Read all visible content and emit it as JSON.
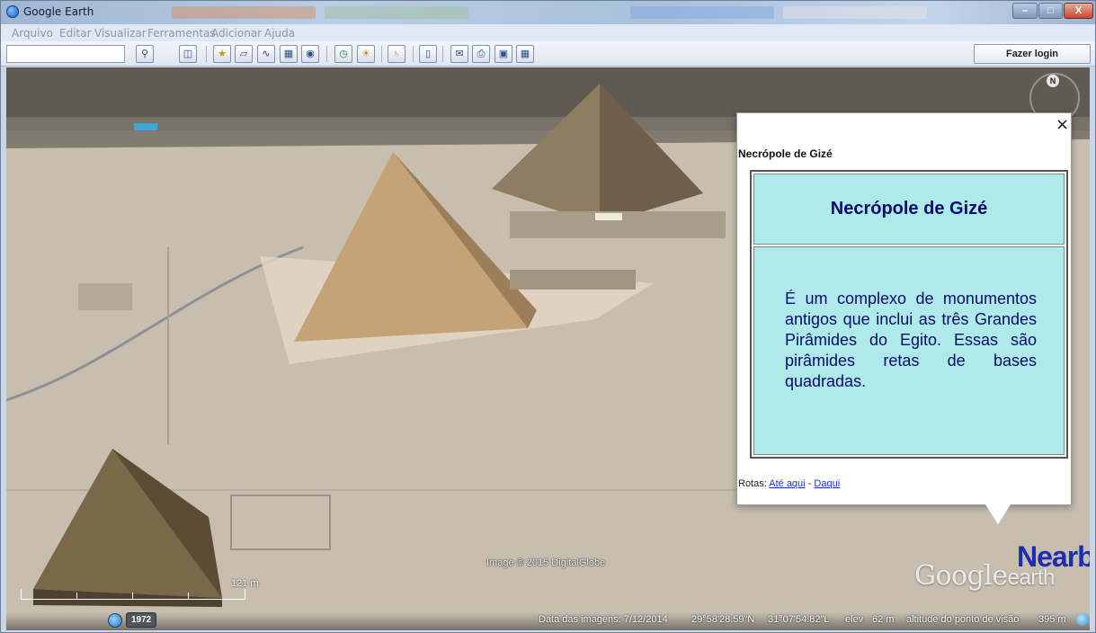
{
  "window": {
    "title": "Google Earth",
    "controls": {
      "minimize": "–",
      "maximize": "□",
      "close": "X"
    }
  },
  "menu": [
    "Arquivo",
    "Editar",
    "Visualizar",
    "Ferramentas",
    "Adicionar",
    "Ajuda"
  ],
  "toolbar": {
    "search_value": "",
    "login_label": "Fazer login",
    "icons": [
      "search-icon",
      "sidebar-toggle-icon",
      "add-placemark-icon",
      "add-polygon-icon",
      "add-path-icon",
      "add-overlay-icon",
      "record-tour-icon",
      "historical-imagery-icon",
      "sunlight-icon",
      "planets-icon",
      "ruler-icon",
      "email-icon",
      "print-icon",
      "save-image-icon",
      "view-in-maps-icon"
    ]
  },
  "balloon": {
    "close": "×",
    "title": "Necrópole de Gizé",
    "heading": "Necrópole de Gizé",
    "description": "É um complexo de monumentos antigos que inclui as três Grandes Pirâmides do Egito. Essas são pirâmides retas de bases quadradas.",
    "routes_prefix": "Rotas:",
    "route_to": "Até aqui",
    "route_separator": "-",
    "route_from": "Daqui"
  },
  "viewport": {
    "imagery_credit": "Image © 2015 DigitalGlobe",
    "logo_main": "Google",
    "logo_suffix": "earth",
    "scale_label": "121 m",
    "compass_label": "N",
    "historical_year": "1972",
    "nearby_fragment": "Nearb"
  },
  "status": {
    "imagery_date": "Data das imagens: 7/12/2014",
    "latitude": "29°58'28.59\"N",
    "longitude": "31°07'54.82\"L",
    "elev_label": "elev",
    "elev_value": "62 m",
    "eye_alt_label": "altitude do ponto de visão",
    "eye_alt_value": "395 m"
  },
  "colors": {
    "balloon_cell": "#aeeaea",
    "balloon_text": "#0a0a6e",
    "link": "#1a33cc"
  }
}
